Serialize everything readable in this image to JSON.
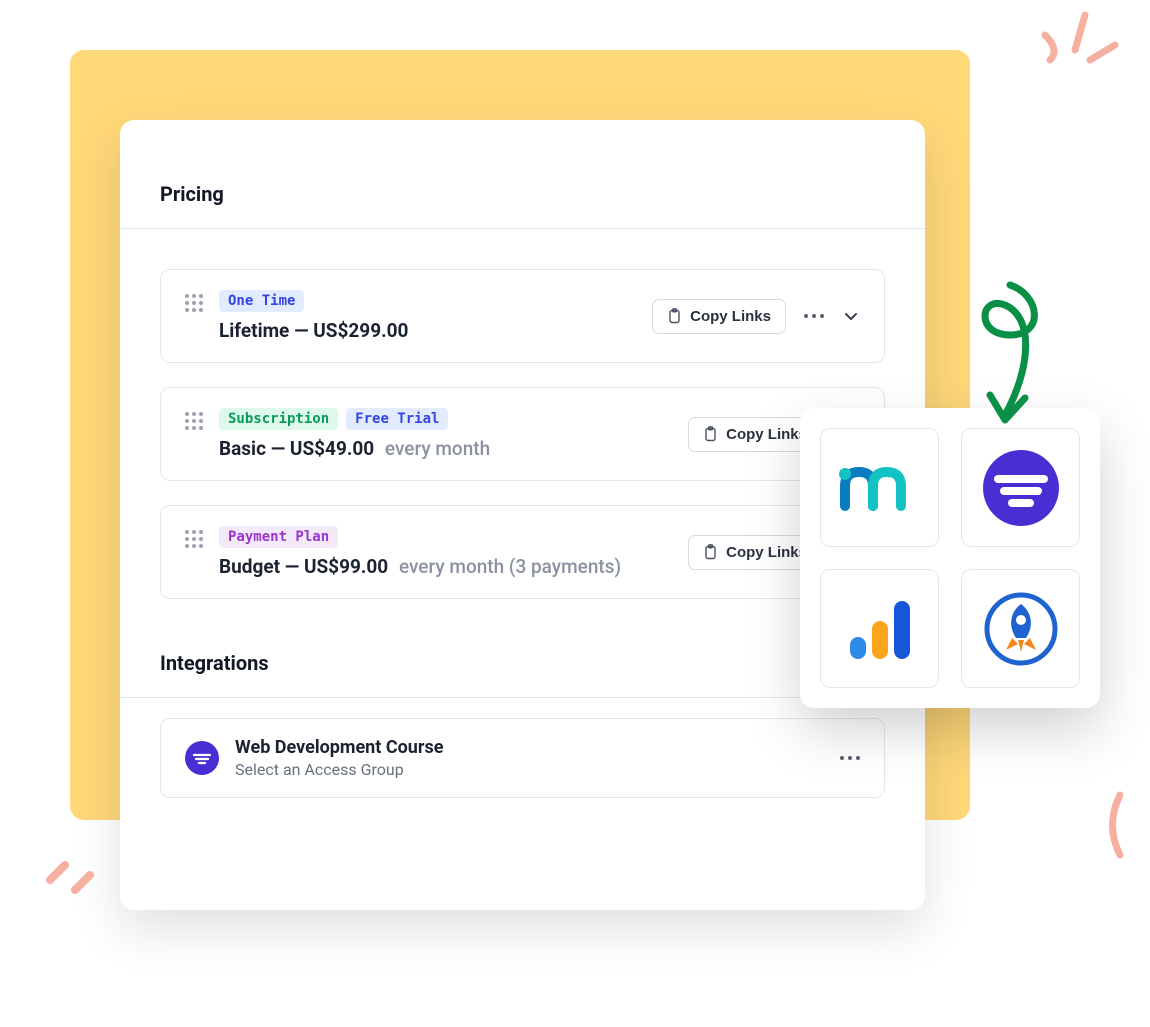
{
  "sections": {
    "pricing_title": "Pricing",
    "integrations_title": "Integrations"
  },
  "pricing": [
    {
      "badges": [
        {
          "text": "One Time",
          "class": "badge-blue"
        }
      ],
      "name": "Lifetime",
      "price": "US$299.00",
      "suffix": "",
      "copy_label": "Copy Links"
    },
    {
      "badges": [
        {
          "text": "Subscription",
          "class": "badge-green"
        },
        {
          "text": "Free Trial",
          "class": "badge-blue2"
        }
      ],
      "name": "Basic",
      "price": "US$49.00",
      "suffix": "every month",
      "copy_label": "Copy Links"
    },
    {
      "badges": [
        {
          "text": "Payment Plan",
          "class": "badge-purple"
        }
      ],
      "name": "Budget",
      "price": "US$99.00",
      "suffix": "every month (3 payments)",
      "copy_label": "Copy Links"
    }
  ],
  "integration": {
    "name": "Web Development Course",
    "sub": "Select an Access Group"
  },
  "apps": [
    {
      "id": "app-memberstack"
    },
    {
      "id": "app-circle"
    },
    {
      "id": "app-analytics"
    },
    {
      "id": "app-rocket"
    }
  ]
}
